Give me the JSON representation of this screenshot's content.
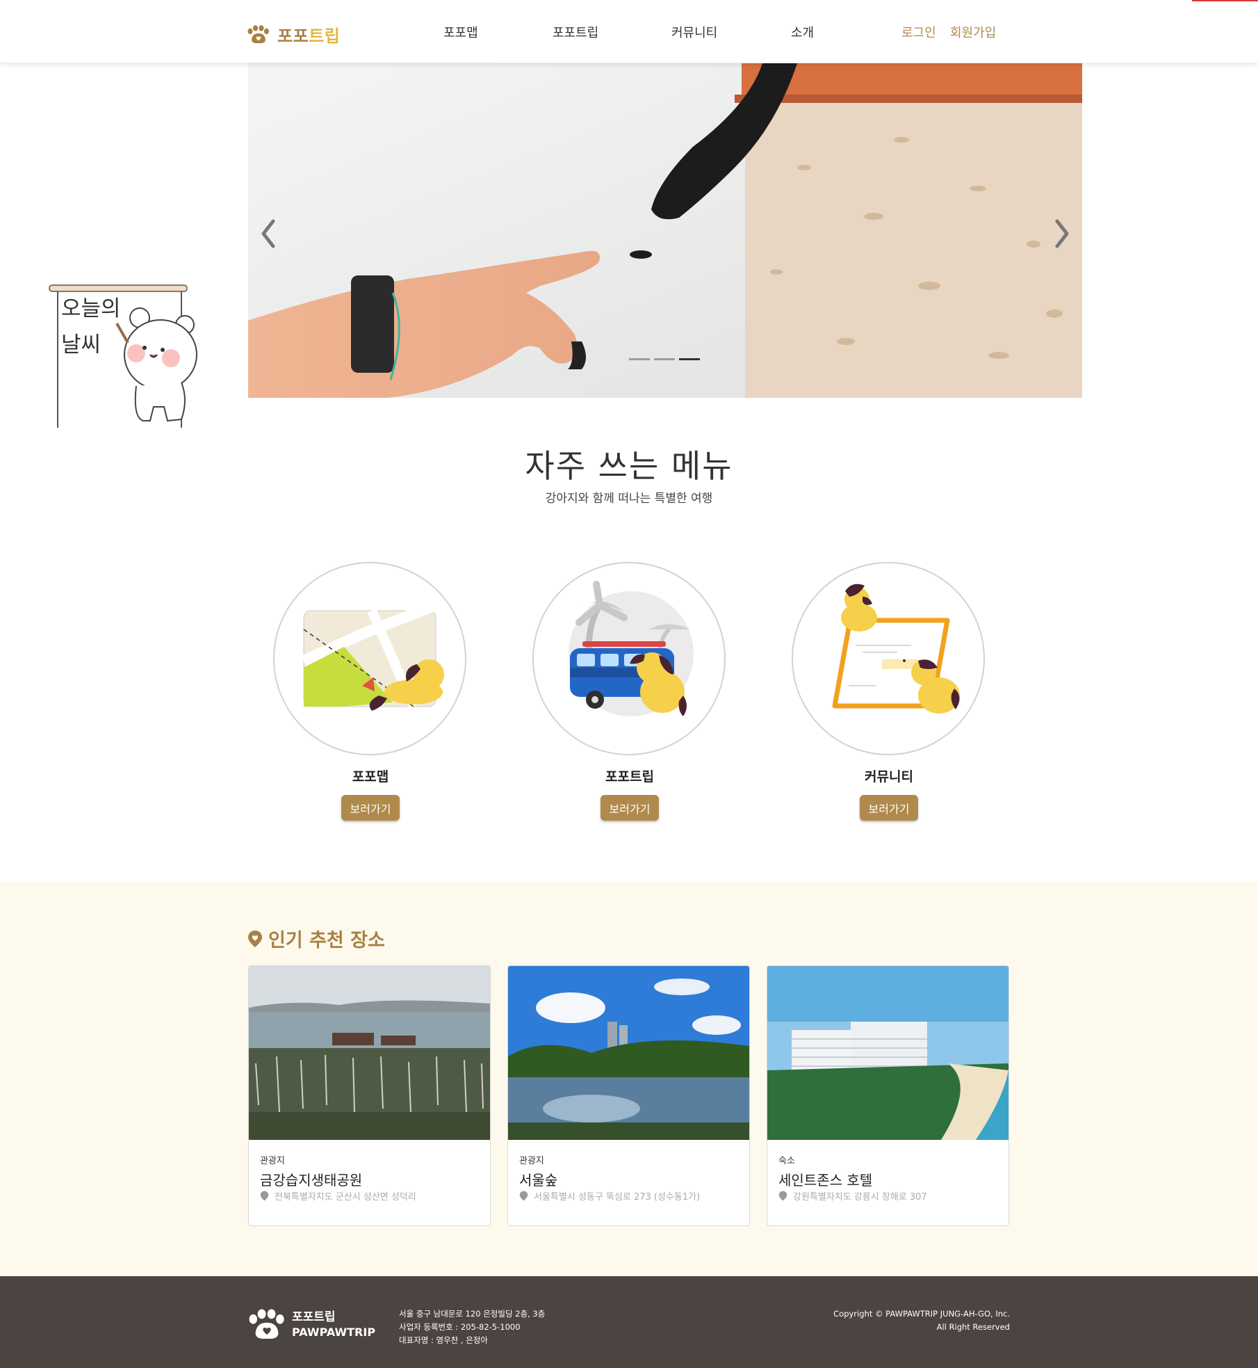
{
  "header": {
    "logo_text_a": "포포",
    "logo_text_b": "트립",
    "nav": [
      "포포맵",
      "포포트립",
      "커뮤니티",
      "소개"
    ],
    "login": "로그인",
    "signup": "회원가입"
  },
  "slider": {
    "slide_count": 3,
    "active_index": 2
  },
  "weather": {
    "line1": "오늘의",
    "line2": "날씨"
  },
  "frequent": {
    "title": "자주 쓰는 메뉴",
    "subtitle": "강아지와 함께 떠나는 특별한 여행",
    "items": [
      {
        "name": "포포맵",
        "button": "보러가기"
      },
      {
        "name": "포포트립",
        "button": "보러가기"
      },
      {
        "name": "커뮤니티",
        "button": "보러가기"
      }
    ]
  },
  "popular": {
    "title": "인기 추천 장소",
    "places": [
      {
        "category": "관광지",
        "name": "금강습지생태공원",
        "address": "전북특별자치도 군산시 성산면 성덕리"
      },
      {
        "category": "관광지",
        "name": "서울숲",
        "address": "서울특별시 성동구 뚝섬로 273 (성수동1가)"
      },
      {
        "category": "숙소",
        "name": "세인트존스 호텔",
        "address": "강원특별자치도 강릉시 창해로 307"
      }
    ]
  },
  "footer": {
    "logo_kr": "포포트립",
    "logo_en": "PAWPAWTRIP",
    "address": "서울 중구 남대문로 120 은정빌딩 2층, 3층",
    "business_no": "사업자 등록번호 : 205-82-5-1000",
    "ceo": "대표자명 : 영우찬 , 은정아",
    "copyright": "Copyright © PAWPAWTRIP JUNG-AH-GO, Inc.",
    "rights": "All Right Reserved"
  },
  "colors": {
    "brand_brown": "#b08a4c",
    "brand_yellow": "#e3b73c",
    "cream_bg": "#fdf9ec",
    "footer_bg": "#4c4441"
  }
}
